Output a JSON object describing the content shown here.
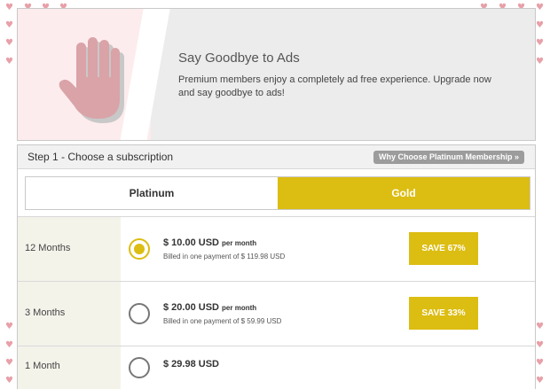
{
  "banner": {
    "title": "Say Goodbye to Ads",
    "text": "Premium members enjoy a completely ad free experience. Upgrade now and say goodbye to ads!"
  },
  "panel": {
    "step_title": "Step 1 - Choose a subscription",
    "why_button": "Why Choose Platinum Membership »"
  },
  "tabs": {
    "platinum": "Platinum",
    "gold": "Gold",
    "selected": "Gold"
  },
  "plans": [
    {
      "label": "12 Months",
      "price": "$ 10.00 USD",
      "per": "per month",
      "billed": "Billed in one payment of $ 119.98 USD",
      "save": "SAVE 67%",
      "selected": true
    },
    {
      "label": "3 Months",
      "price": "$ 20.00 USD",
      "per": "per month",
      "billed": "Billed in one payment of $ 59.99 USD",
      "save": "SAVE 33%",
      "selected": false
    },
    {
      "label": "1 Month",
      "price": "$ 29.98 USD",
      "selected": false
    }
  ],
  "colors": {
    "accent_gold": "#dcbd12",
    "heart_pink": "#e8a0a8"
  }
}
